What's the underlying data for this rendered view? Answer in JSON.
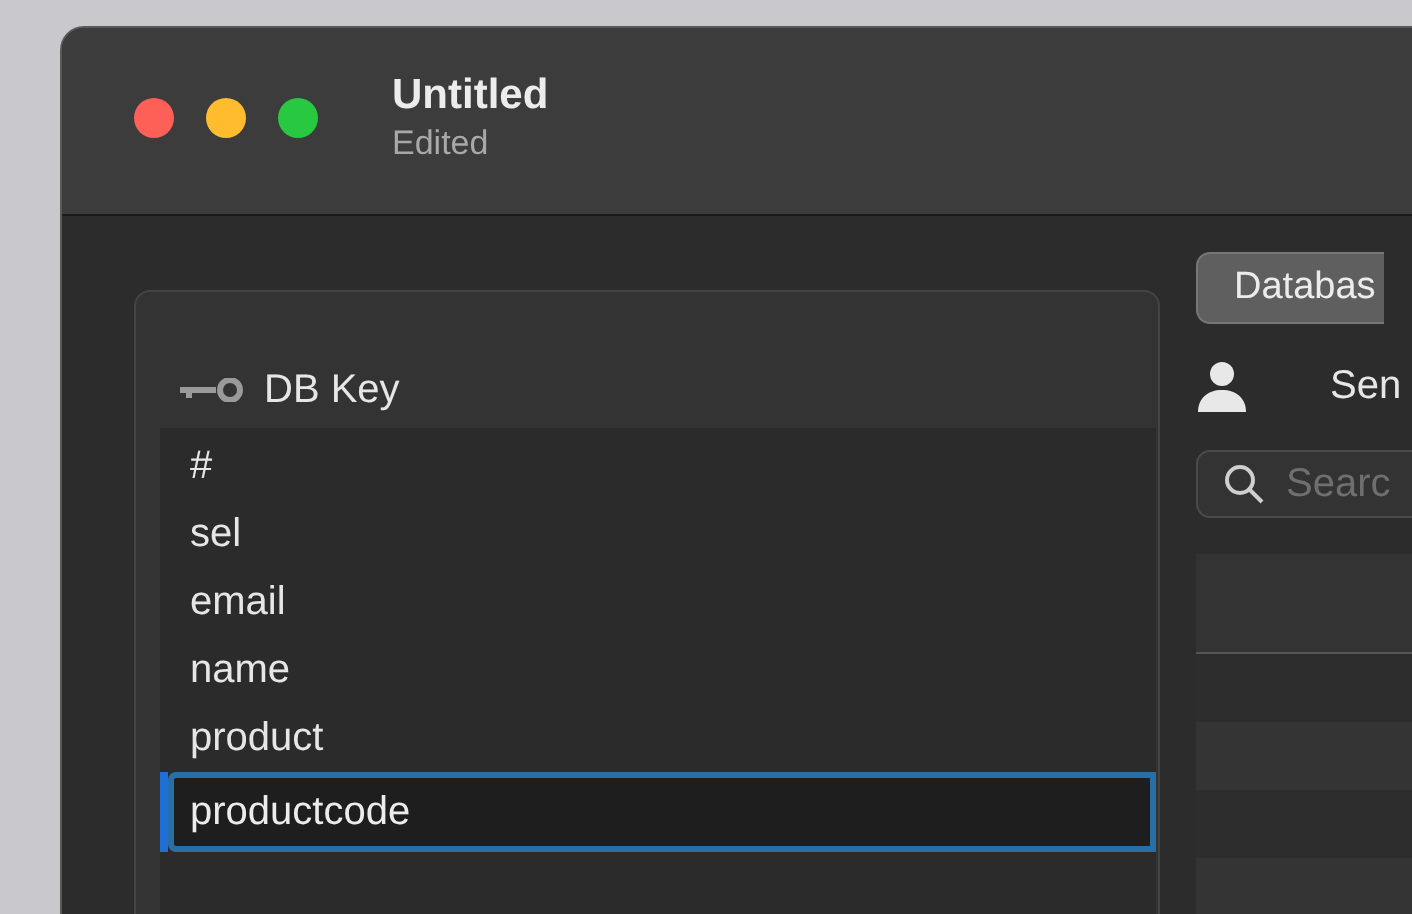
{
  "window": {
    "title": "Untitled",
    "subtitle": "Edited"
  },
  "key_panel": {
    "title": "DB Key",
    "keys": [
      {
        "kind": "text",
        "label": "#"
      },
      {
        "kind": "text",
        "label": "sel"
      },
      {
        "kind": "text",
        "label": "email"
      },
      {
        "kind": "text",
        "label": "name"
      },
      {
        "kind": "text",
        "label": "product"
      },
      {
        "kind": "editing",
        "label": "productcode"
      }
    ]
  },
  "right_panel": {
    "tab": "Databas",
    "user_label": "Sen",
    "search": {
      "placeholder": "Searc"
    }
  }
}
